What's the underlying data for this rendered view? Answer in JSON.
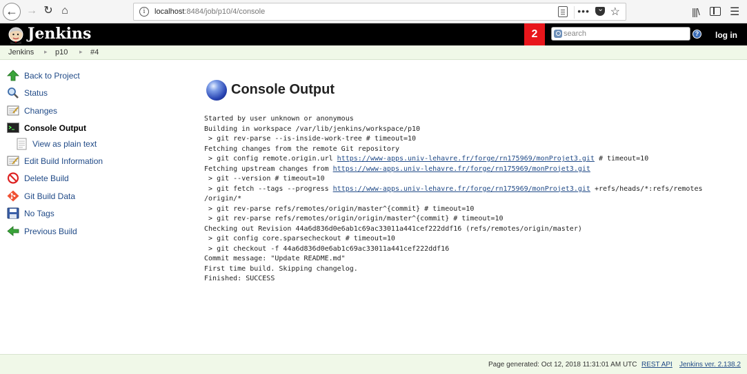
{
  "browser": {
    "url_host": "localhost",
    "url_path": ":8484/job/p10/4/console",
    "more_label": "•••"
  },
  "header": {
    "title": "Jenkins",
    "notification_count": "2",
    "search_placeholder": "search",
    "help_label": "?",
    "login_label": "log in",
    "accent_color": "#e8161b"
  },
  "breadcrumb": [
    "Jenkins",
    "p10",
    "#4"
  ],
  "sidebar": {
    "items": [
      {
        "label": "Back to Project",
        "icon": "green-up-arrow-icon"
      },
      {
        "label": "Status",
        "icon": "magnifier-icon"
      },
      {
        "label": "Changes",
        "icon": "notepad-icon"
      },
      {
        "label": "Console Output",
        "icon": "terminal-icon"
      },
      {
        "label": "View as plain text",
        "icon": "document-icon"
      },
      {
        "label": "Edit Build Information",
        "icon": "notepad-pencil-icon"
      },
      {
        "label": "Delete Build",
        "icon": "no-entry-icon"
      },
      {
        "label": "Git Build Data",
        "icon": "git-icon"
      },
      {
        "label": "No Tags",
        "icon": "floppy-disk-icon"
      },
      {
        "label": "Previous Build",
        "icon": "green-left-arrow-icon"
      }
    ]
  },
  "main": {
    "title": "Console Output",
    "console": {
      "l1": "Started by user unknown or anonymous",
      "l2": "Building in workspace /var/lib/jenkins/workspace/p10",
      "l3": " > git rev-parse --is-inside-work-tree # timeout=10",
      "l4": "Fetching changes from the remote Git repository",
      "l5a": " > git config remote.origin.url ",
      "repo_url": "https://www-apps.univ-lehavre.fr/forge/rn175969/monProjet3.git",
      "l5b": " # timeout=10",
      "l6a": "Fetching upstream changes from ",
      "l7": " > git --version # timeout=10",
      "l8a": " > git fetch --tags --progress ",
      "l8b": " +refs/heads/*:refs/remotes",
      "l9": "/origin/*",
      "l10": " > git rev-parse refs/remotes/origin/master^{commit} # timeout=10",
      "l11": " > git rev-parse refs/remotes/origin/origin/master^{commit} # timeout=10",
      "l12": "Checking out Revision 44a6d836d0e6ab1c69ac33011a441cef222ddf16 (refs/remotes/origin/master)",
      "l13": " > git config core.sparsecheckout # timeout=10",
      "l14": " > git checkout -f 44a6d836d0e6ab1c69ac33011a441cef222ddf16",
      "l15": "Commit message: \"Update README.md\"",
      "l16": "First time build. Skipping changelog.",
      "l17": "Finished: SUCCESS"
    }
  },
  "footer": {
    "generated": "Page generated: Oct 12, 2018 11:31:01 AM UTC",
    "rest_api": "REST API",
    "version": "Jenkins ver. 2.138.2"
  }
}
